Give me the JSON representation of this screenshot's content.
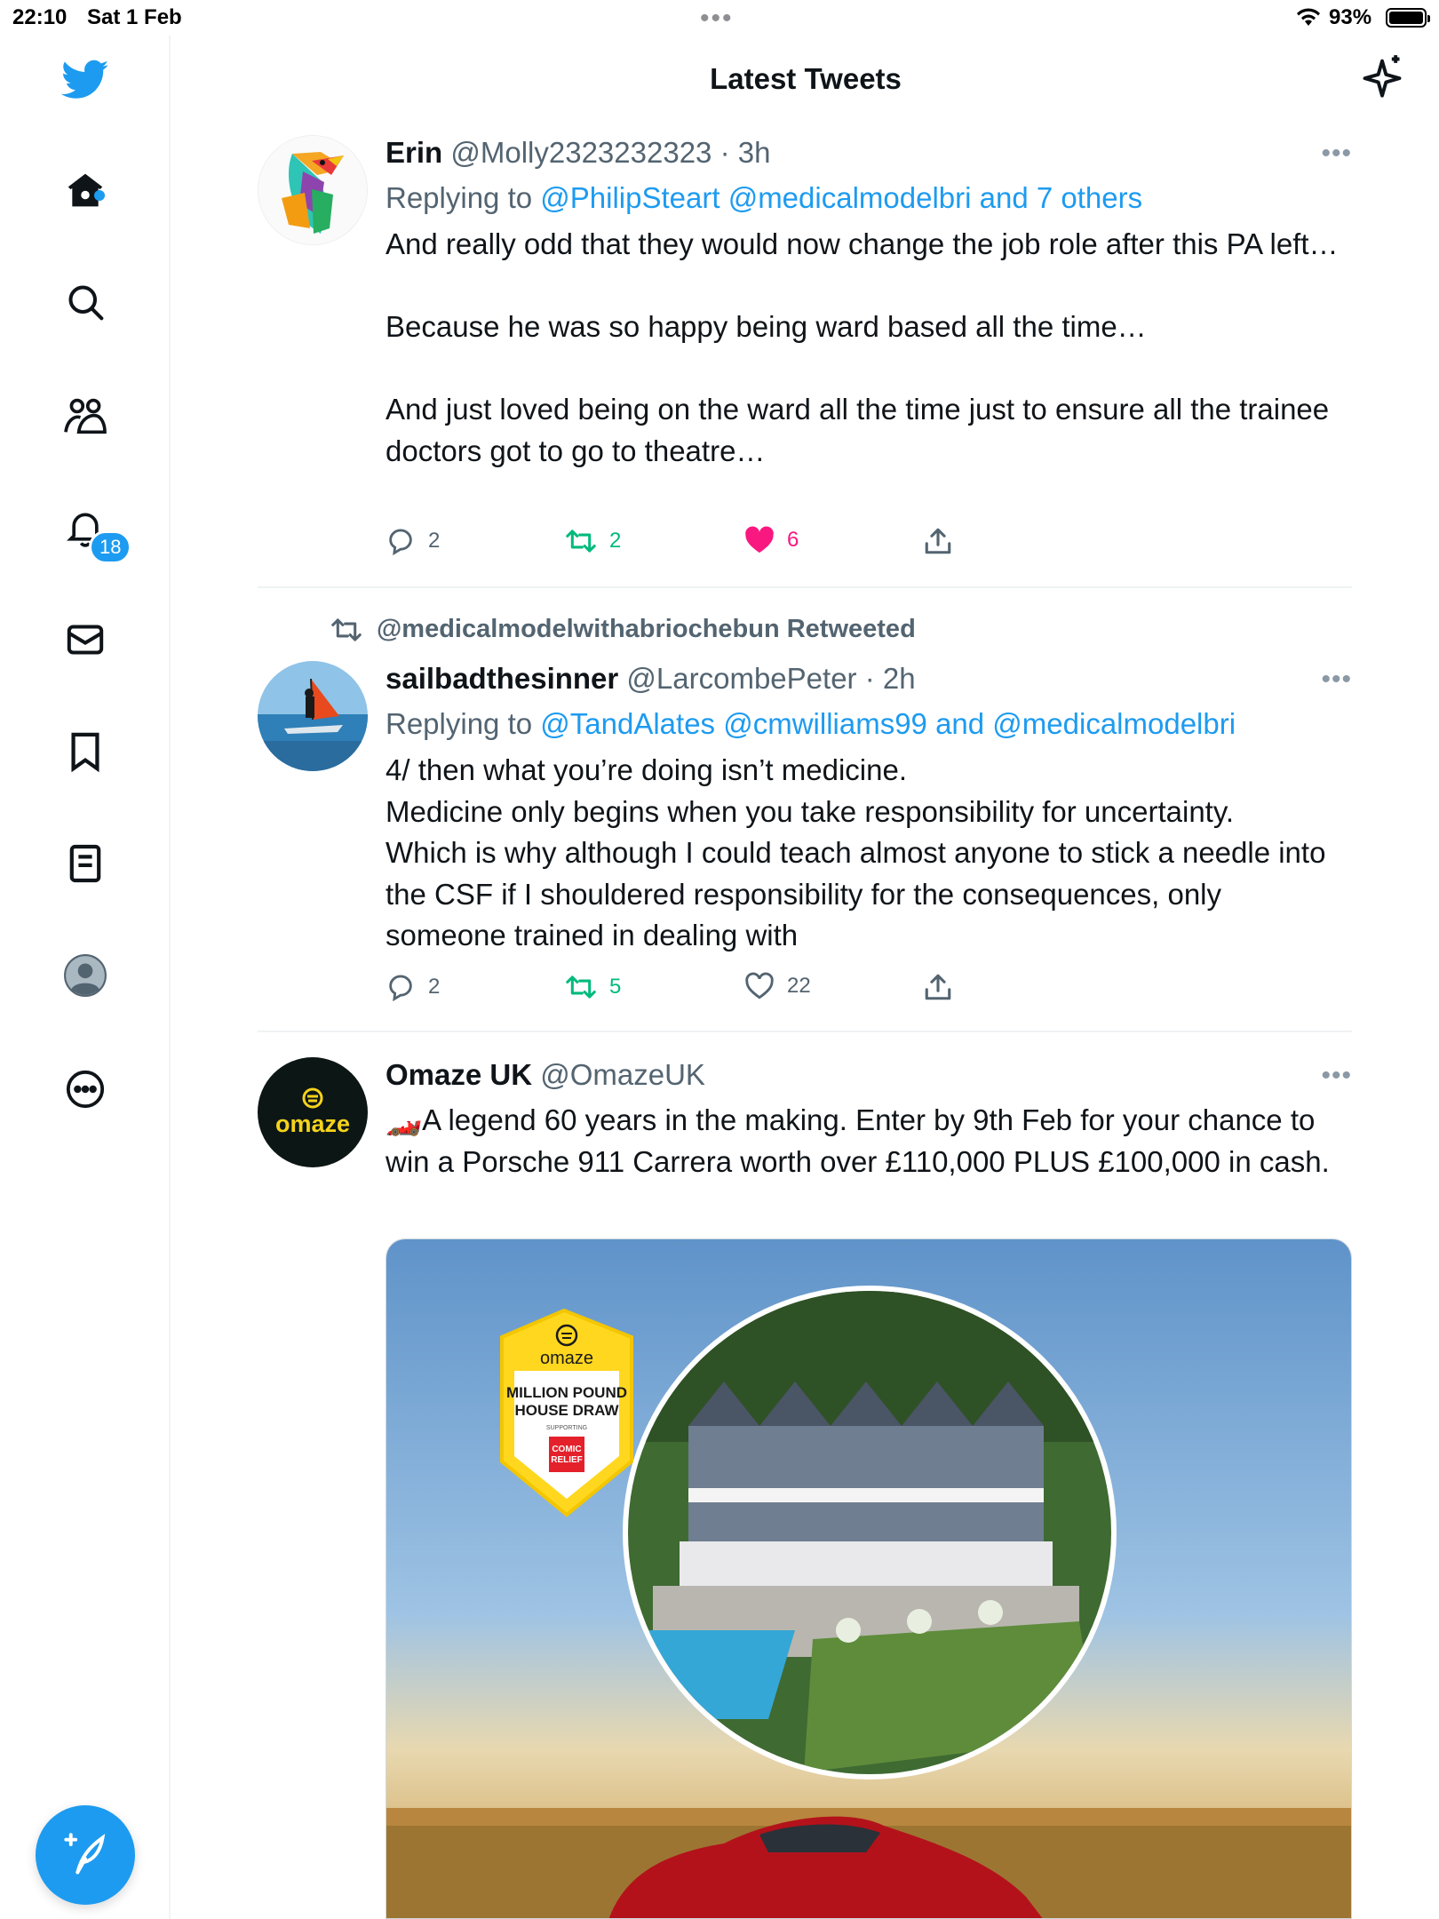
{
  "status_bar": {
    "time": "22:10",
    "date": "Sat 1 Feb",
    "battery": "93%"
  },
  "header": {
    "title": "Latest Tweets"
  },
  "sidebar": {
    "notifications_badge": "18",
    "items": [
      "twitter-logo",
      "home",
      "search",
      "communities",
      "notifications",
      "messages",
      "bookmarks",
      "lists",
      "profile",
      "more"
    ]
  },
  "tweets": [
    {
      "name": "Erin",
      "meta": "@Molly2323232323 · 3h",
      "replying_prefix": "Replying to ",
      "replying_to": "@PhilipSteart @medicalmodelbri and 7 others",
      "text": "And really odd that they would now change the job role after this PA left…\n\nBecause he was so happy being ward based all the time…\n\nAnd just loved being on the ward all the time just to ensure all the trainee doctors got to go to theatre…",
      "replies": "2",
      "retweets": "2",
      "likes": "6"
    },
    {
      "retweeted_by": "@medicalmodelwithabriochebun Retweeted",
      "name": "sailbadthesinner",
      "meta": "@LarcombePeter · 2h",
      "replying_prefix": "Replying to ",
      "replying_to": "@TandAlates @cmwilliams99 and @medicalmodelbri",
      "text": "4/ then what you’re doing isn’t medicine.\nMedicine only begins when you take responsibility for uncertainty.\nWhich is why although I could teach almost anyone to stick a needle into the CSF if I shouldered responsibility for the consequences, only someone trained in dealing with",
      "replies": "2",
      "retweets": "5",
      "likes": "22"
    },
    {
      "name": "Omaze UK",
      "meta": "@OmazeUK",
      "avatar_text": "omaze",
      "text": "🏎️A legend 60 years in the making. Enter by 9th Feb for your chance to win a Porsche 911 Carrera worth over £110,000 PLUS £100,000 in cash.",
      "media": {
        "badge_brand": "omaze",
        "badge_title_1": "MILLION POUND",
        "badge_title_2": "HOUSE DRAW",
        "badge_supporting": "SUPPORTING",
        "badge_charity_1": "COMIC",
        "badge_charity_2": "RELIEF"
      }
    }
  ],
  "colors": {
    "accent": "#1d9bf0",
    "retweet": "#00ba7c",
    "like": "#f91880",
    "muted": "#536471"
  }
}
